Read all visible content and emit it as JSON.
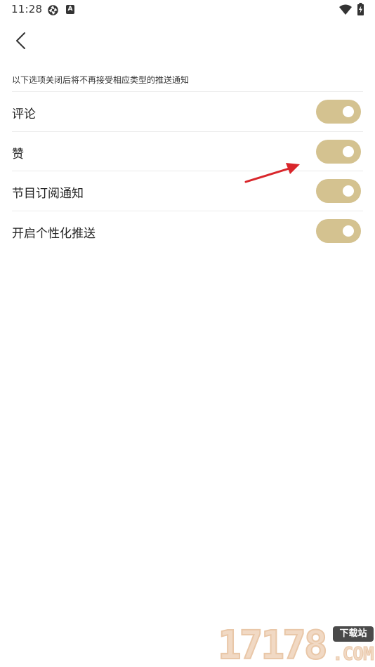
{
  "status_bar": {
    "time": "11:28",
    "icons": [
      "aperture-icon",
      "a-badge-icon",
      "wifi-icon",
      "battery-charging-icon"
    ],
    "a_badge_letter": "A"
  },
  "header": {
    "back_icon": "chevron-left-icon"
  },
  "subtitle": "以下选项关闭后将不再接受相应类型的推送通知",
  "settings": [
    {
      "label": "评论",
      "enabled": true
    },
    {
      "label": "赞",
      "enabled": true
    },
    {
      "label": "节目订阅通知",
      "enabled": true
    },
    {
      "label": "开启个性化推送",
      "enabled": true
    }
  ],
  "colors": {
    "toggle_on": "#d4c290",
    "annotation_arrow": "#d9262b"
  },
  "watermark": {
    "digits": "17178",
    "badge": "下载站",
    "domain": ".COM"
  }
}
